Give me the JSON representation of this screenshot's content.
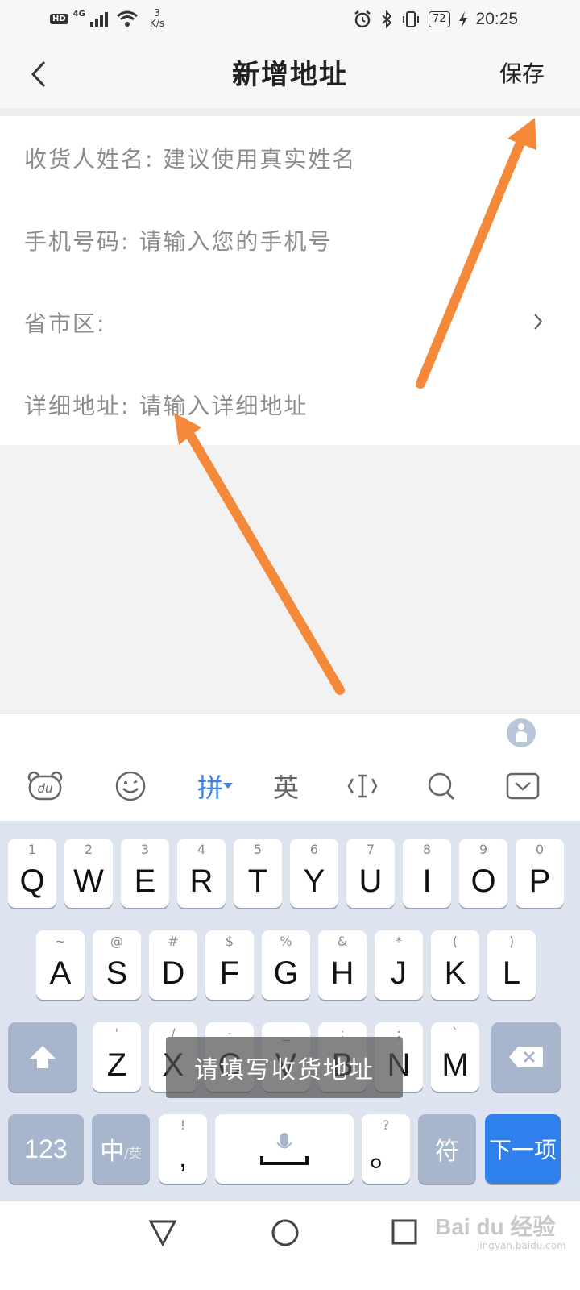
{
  "status_bar": {
    "hd": "HD",
    "network": "4G",
    "speed_value": "3",
    "speed_unit": "K/s",
    "battery": "72",
    "time": "20:25"
  },
  "header": {
    "title": "新增地址",
    "save_label": "保存"
  },
  "form": {
    "name": {
      "label": "收货人姓名:",
      "placeholder": "建议使用真实姓名"
    },
    "phone": {
      "label": "手机号码:",
      "placeholder": "请输入您的手机号"
    },
    "region": {
      "label": "省市区:",
      "value": ""
    },
    "detail": {
      "label": "详细地址:",
      "placeholder": "请输入详细地址"
    }
  },
  "keyboard": {
    "toolbar": {
      "du": "du",
      "pinyin": "拼",
      "english": "英"
    },
    "row1": [
      {
        "hint": "1",
        "key": "Q"
      },
      {
        "hint": "2",
        "key": "W"
      },
      {
        "hint": "3",
        "key": "E"
      },
      {
        "hint": "4",
        "key": "R"
      },
      {
        "hint": "5",
        "key": "T"
      },
      {
        "hint": "6",
        "key": "Y"
      },
      {
        "hint": "7",
        "key": "U"
      },
      {
        "hint": "8",
        "key": "I"
      },
      {
        "hint": "9",
        "key": "O"
      },
      {
        "hint": "0",
        "key": "P"
      }
    ],
    "row2": [
      {
        "hint": "~",
        "key": "A"
      },
      {
        "hint": "@",
        "key": "S"
      },
      {
        "hint": "#",
        "key": "D"
      },
      {
        "hint": "$",
        "key": "F"
      },
      {
        "hint": "%",
        "key": "G"
      },
      {
        "hint": "&",
        "key": "H"
      },
      {
        "hint": "*",
        "key": "J"
      },
      {
        "hint": "(",
        "key": "K"
      },
      {
        "hint": ")",
        "key": "L"
      }
    ],
    "row3": [
      {
        "hint": "'",
        "key": "Z"
      },
      {
        "hint": "/",
        "key": "X"
      },
      {
        "hint": "-",
        "key": "C"
      },
      {
        "hint": "_",
        "key": "V"
      },
      {
        "hint": ":",
        "key": "B"
      },
      {
        "hint": ";",
        "key": "N"
      },
      {
        "hint": "`",
        "key": "M"
      }
    ],
    "num_key": "123",
    "lang_key_main": "中",
    "lang_key_sub": "/英",
    "comma_hint": "!",
    "comma_key": ",",
    "period_hint": "?",
    "period_key": "。",
    "symbol_key": "符",
    "next_key": "下一项",
    "toast": "请填写收货地址"
  },
  "watermark": {
    "brand": "Bai du 经验",
    "sub": "jingyan.baidu.com"
  },
  "colors": {
    "accent_blue": "#2f80ed",
    "arrow_orange": "#f5893a",
    "keyboard_bg": "#dde3ef",
    "dark_key": "#a7b5cd"
  }
}
